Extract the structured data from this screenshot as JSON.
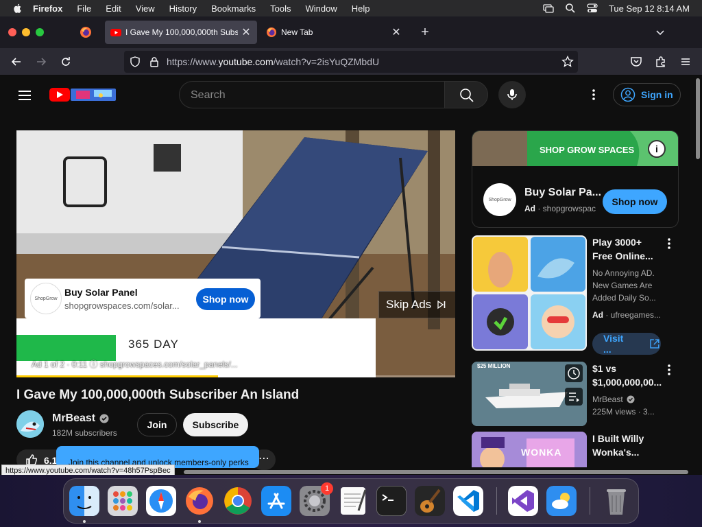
{
  "menubar": {
    "app_name": "Firefox",
    "items": [
      "File",
      "Edit",
      "View",
      "History",
      "Bookmarks",
      "Tools",
      "Window",
      "Help"
    ],
    "clock": "Tue Sep 12  8:14 AM"
  },
  "browser": {
    "tabs": [
      {
        "label": "I Gave My 100,000,000th Subsc",
        "active": true
      },
      {
        "label": "New Tab",
        "active": false
      }
    ],
    "url_prefix": "https://www.",
    "url_domain": "youtube.com",
    "url_path": "/watch?v=2isYuQZMbdU",
    "status_url": "https://www.youtube.com/watch?v=48h57PspBec"
  },
  "youtube": {
    "search_placeholder": "Search",
    "sign_in": "Sign in",
    "player": {
      "ad_card_title": "Buy Solar Panel",
      "ad_card_url": "shopgrowspaces.com/solar...",
      "ad_card_cta": "Shop now",
      "ad_card_logo": "ShopGrow",
      "skip_label": "Skip Ads",
      "strip_text": "365 DAY",
      "ad_info": "Ad 1 of 2 · 0:11",
      "ad_info_url": "shopgrowspaces.com/solar_panels/...",
      "progress": 0.46
    },
    "video": {
      "title": "I Gave My 100,000,000th Subscriber An Island",
      "channel": "MrBeast",
      "subscribers": "182M subscribers",
      "join": "Join",
      "subscribe": "Subscribe",
      "likes": "6.1",
      "tooltip": "Join this channel and unlock members-only perks"
    },
    "sidebar_ad": {
      "banner": "SHOP GROW SPACES",
      "title": "Buy Solar Pa...",
      "ad_label": "Ad",
      "domain": "· shopgrowspaces",
      "cta": "Shop now",
      "logo": "ShopGrow"
    },
    "recommendations": [
      {
        "title": "Play 3000+ Free Online...",
        "desc": "No Annoying AD. New Games Are Added Daily So...",
        "ad_label": "Ad",
        "ad_domain": "· ufreegames...",
        "cta": "Visit ..."
      },
      {
        "title": "$1 vs $1,000,000,00...",
        "channel": "MrBeast",
        "meta": "225M views  · 3...",
        "thumb_label": "$25 MILLION"
      },
      {
        "title": "I Built Willy Wonka's...",
        "thumb_label": "WONKA"
      }
    ]
  },
  "dock": {
    "apps": [
      "Finder",
      "Launchpad",
      "Safari",
      "Firefox",
      "Chrome",
      "App Store",
      "System Settings",
      "TextEdit",
      "Terminal",
      "GarageBand",
      "VS Code",
      "Visual Studio",
      "Weather",
      "Trash"
    ],
    "settings_badge": "1"
  },
  "colors": {
    "yt_red": "#ff0000",
    "yt_blue": "#3ea6ff",
    "ad_progress": "#ffcc00",
    "ad_green": "#1fb84a"
  }
}
